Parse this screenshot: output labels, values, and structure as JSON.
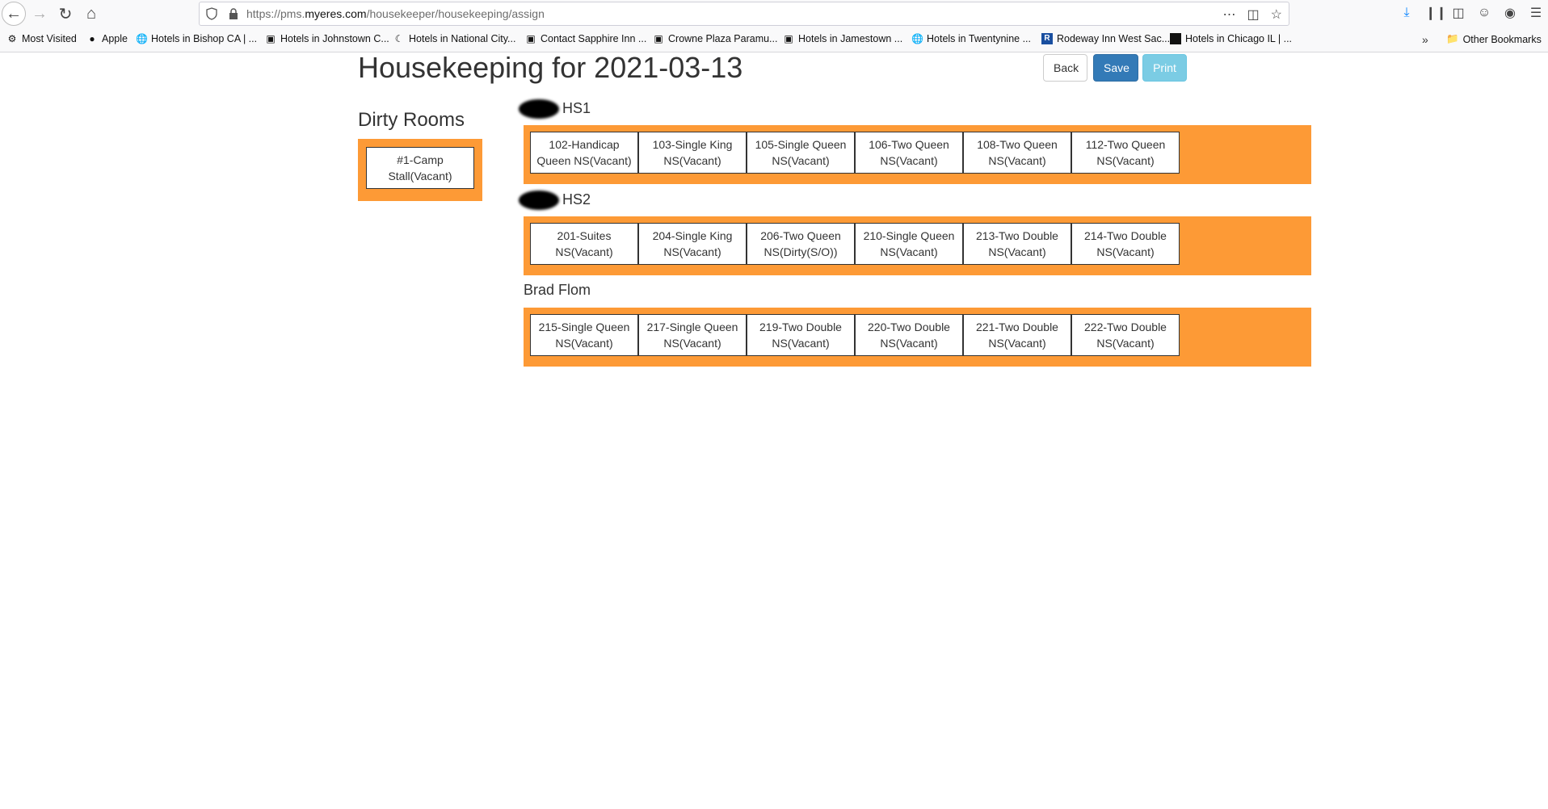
{
  "browser": {
    "url_prefix": "https://pms.",
    "url_host": "myeres.com",
    "url_path": "/housekeeper/housekeeping/assign"
  },
  "bookmarks": [
    {
      "label": "Most Visited",
      "icon": "gear-icon"
    },
    {
      "label": "Apple",
      "icon": "apple-icon"
    },
    {
      "label": "Hotels in Bishop CA | ...",
      "icon": "globe-icon"
    },
    {
      "label": "Hotels in Johnstown C...",
      "icon": "image-icon"
    },
    {
      "label": "Hotels in National City...",
      "icon": "moon-icon"
    },
    {
      "label": "Contact Sapphire Inn ...",
      "icon": "image-icon"
    },
    {
      "label": "Crowne Plaza Paramu...",
      "icon": "image-icon"
    },
    {
      "label": "Hotels in Jamestown ...",
      "icon": "image-icon"
    },
    {
      "label": "Hotels in Twentynine ...",
      "icon": "globe-icon"
    },
    {
      "label": "Rodeway Inn West Sac...",
      "icon": "r-logo-icon"
    },
    {
      "label": "Hotels in Chicago IL | ...",
      "icon": "dark-square-icon"
    }
  ],
  "other_bookmarks": "Other Bookmarks",
  "page": {
    "title": "Housekeeping for 2021-03-13",
    "buttons": {
      "back": "Back",
      "save": "Save",
      "print": "Print"
    },
    "dirty_title": "Dirty Rooms",
    "dirty_rooms": [
      {
        "line1": "#1-Camp",
        "line2": "Stall(Vacant)"
      }
    ],
    "groups": [
      {
        "name": "HS1",
        "redacted": true,
        "rooms": [
          {
            "line1": "102-Handicap",
            "line2": "Queen NS(Vacant)"
          },
          {
            "line1": "103-Single King",
            "line2": "NS(Vacant)"
          },
          {
            "line1": "105-Single Queen",
            "line2": "NS(Vacant)"
          },
          {
            "line1": "106-Two Queen",
            "line2": "NS(Vacant)"
          },
          {
            "line1": "108-Two Queen",
            "line2": "NS(Vacant)"
          },
          {
            "line1": "112-Two Queen",
            "line2": "NS(Vacant)"
          }
        ]
      },
      {
        "name": "HS2",
        "redacted": true,
        "rooms": [
          {
            "line1": "201-Suites",
            "line2": "NS(Vacant)"
          },
          {
            "line1": "204-Single King",
            "line2": "NS(Vacant)"
          },
          {
            "line1": "206-Two Queen",
            "line2": "NS(Dirty(S/O))"
          },
          {
            "line1": "210-Single Queen",
            "line2": "NS(Vacant)"
          },
          {
            "line1": "213-Two Double",
            "line2": "NS(Vacant)"
          },
          {
            "line1": "214-Two Double",
            "line2": "NS(Vacant)"
          }
        ]
      },
      {
        "name": "Brad Flom",
        "redacted": false,
        "rooms": [
          {
            "line1": "215-Single Queen",
            "line2": "NS(Vacant)"
          },
          {
            "line1": "217-Single Queen",
            "line2": "NS(Vacant)"
          },
          {
            "line1": "219-Two Double",
            "line2": "NS(Vacant)"
          },
          {
            "line1": "220-Two Double",
            "line2": "NS(Vacant)"
          },
          {
            "line1": "221-Two Double",
            "line2": "NS(Vacant)"
          },
          {
            "line1": "222-Two Double",
            "line2": "NS(Vacant)"
          }
        ]
      }
    ]
  },
  "colors": {
    "group_bg": "#fd9a36",
    "save": "#337ab7",
    "print": "#5bc0de"
  }
}
